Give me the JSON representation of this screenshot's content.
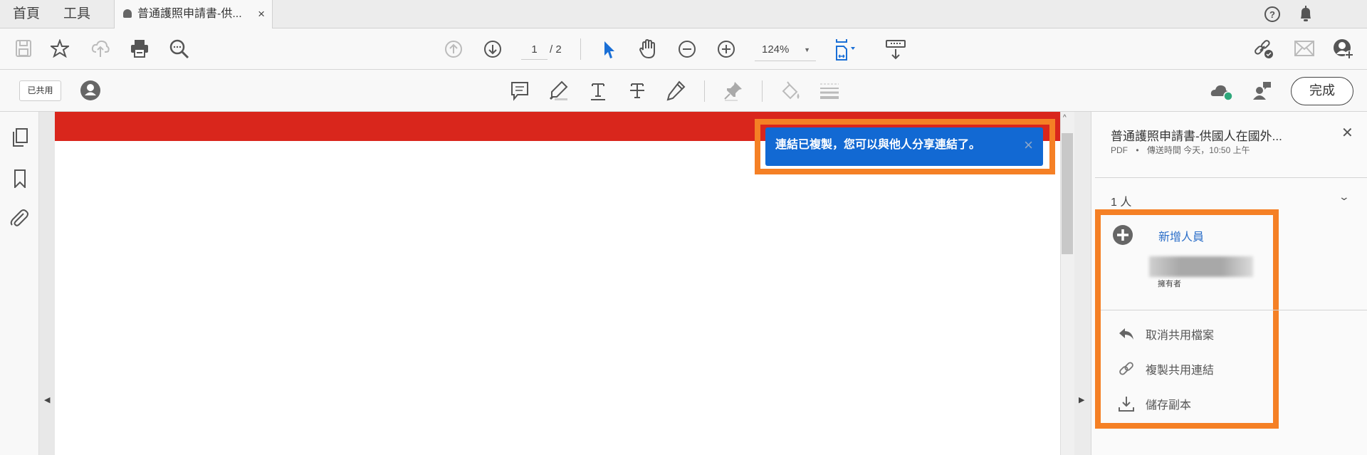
{
  "tabs": {
    "home": "首頁",
    "tools": "工具",
    "document": "普通護照申請書-供...",
    "close": "×"
  },
  "toolbar": {
    "page_current": "1",
    "page_total": "/ 2",
    "zoom": "124%"
  },
  "toolbar2": {
    "shared_label": "已共用",
    "done_label": "完成"
  },
  "toast": {
    "message": "連結已複製，您可以與他人分享連結了。",
    "close": "×"
  },
  "panel": {
    "title": "普通護照申請書-供國人在國外...",
    "file_type": "PDF",
    "bullet": "•",
    "sent_info": "傳送時間 今天，10:50 上午",
    "close": "✕",
    "people_count": "1 人",
    "add_person": "新增人員",
    "owner_role": "擁有者",
    "actions": [
      {
        "label": "取消共用檔案"
      },
      {
        "label": "複製共用連結"
      },
      {
        "label": "儲存副本"
      }
    ]
  },
  "colors": {
    "accent": "#1269d3",
    "highlight": "#f58025",
    "band": "#d9261c"
  }
}
